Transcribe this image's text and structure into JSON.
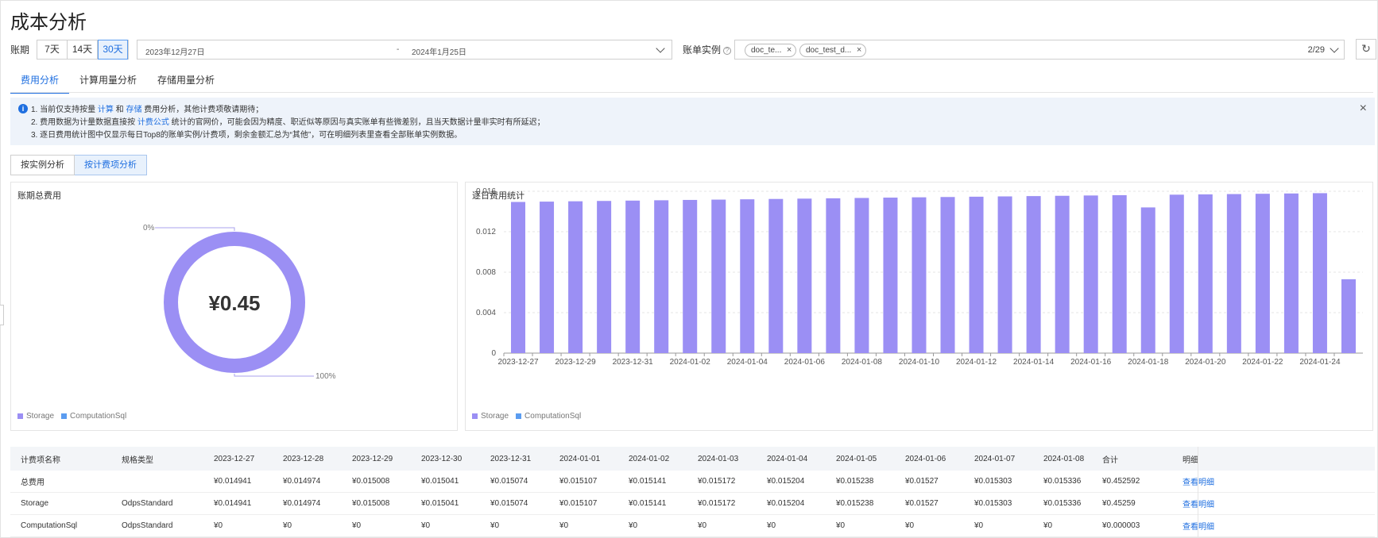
{
  "page": {
    "title": "成本分析"
  },
  "filters": {
    "period_label": "账期",
    "periods": [
      "7天",
      "14天",
      "30天"
    ],
    "active_period": "30天",
    "start_date": "2023年12月27日",
    "separator": "-",
    "end_date": "2024年1月25日",
    "instance_label": "账单实例",
    "help_icon_glyph": "?",
    "instance_tags": [
      "doc_te...",
      "doc_test_d..."
    ],
    "tag_close_glyph": "×",
    "instance_count": "2/29",
    "refresh_glyph": "↻"
  },
  "tabs": [
    "费用分析",
    "计算用量分析",
    "存储用量分析"
  ],
  "active_tab": "费用分析",
  "banner": {
    "info_glyph": "i",
    "close_glyph": "×",
    "line1_pre": "1. 当前仅支持按量 ",
    "line1_link1": "计算",
    "line1_mid": " 和 ",
    "line1_link2": "存储",
    "line1_post": " 费用分析，其他计费项敬请期待；",
    "line2_pre": "2. 费用数据为计量数据直接按 ",
    "line2_link": "计费公式",
    "line2_post": " 统计的官网价，可能会因为精度、职近似等原因与真实账单有些微差别，且当天数据计量非实时有所延迟；",
    "line3": "3. 逐日费用统计图中仅显示每日Top8的账单实例/计费项，剩余金额汇总为“其他”，可在明细列表里查看全部账单实例数据。"
  },
  "analysis_toggle": [
    "按实例分析",
    "按计费项分析"
  ],
  "active_toggle": "按计费项分析",
  "colors": {
    "storage": "#9b8ff4",
    "computation": "#5b9cf0",
    "accent": "#1f6fe0"
  },
  "donut_panel": {
    "title": "账期总费用",
    "center_value": "¥0.45",
    "label_top": "0%",
    "label_bottom": "100%"
  },
  "bar_panel": {
    "title": "逐日费用统计"
  },
  "legend": [
    "Storage",
    "ComputationSql"
  ],
  "chart_data": [
    {
      "type": "pie",
      "title": "账期总费用",
      "categories": [
        "Storage",
        "ComputationSql"
      ],
      "values": [
        0.45259,
        3e-06
      ],
      "center_label": "¥0.45"
    },
    {
      "type": "bar",
      "title": "逐日费用统计",
      "categories": [
        "2023-12-27",
        "2023-12-28",
        "2023-12-29",
        "2023-12-30",
        "2023-12-31",
        "2024-01-01",
        "2024-01-02",
        "2024-01-03",
        "2024-01-04",
        "2024-01-05",
        "2024-01-06",
        "2024-01-07",
        "2024-01-08",
        "2024-01-09",
        "2024-01-10",
        "2024-01-11",
        "2024-01-12",
        "2024-01-13",
        "2024-01-14",
        "2024-01-15",
        "2024-01-16",
        "2024-01-17",
        "2024-01-18",
        "2024-01-19",
        "2024-01-20",
        "2024-01-21",
        "2024-01-22",
        "2024-01-23",
        "2024-01-24",
        "2024-01-25"
      ],
      "x_tick_labels": [
        "2023-12-27",
        "2023-12-29",
        "2023-12-31",
        "2024-01-02",
        "2024-01-04",
        "2024-01-06",
        "2024-01-08",
        "2024-01-10",
        "2024-01-12",
        "2024-01-14",
        "2024-01-16",
        "2024-01-18",
        "2024-01-20",
        "2024-01-22",
        "2024-01-24"
      ],
      "series": [
        {
          "name": "Storage",
          "values": [
            0.014941,
            0.014974,
            0.015008,
            0.015041,
            0.015074,
            0.015107,
            0.015141,
            0.015172,
            0.015204,
            0.015238,
            0.01527,
            0.015303,
            0.015336,
            0.01537,
            0.0154,
            0.01543,
            0.01546,
            0.01549,
            0.01552,
            0.01555,
            0.01558,
            0.01561,
            0.0144,
            0.01566,
            0.01569,
            0.01572,
            0.01575,
            0.01578,
            0.01581,
            0.0073
          ]
        },
        {
          "name": "ComputationSql",
          "values": [
            0,
            0,
            0,
            0,
            0,
            0,
            0,
            0,
            0,
            0,
            0,
            0,
            0,
            0,
            0,
            0,
            0,
            0,
            0,
            0,
            0,
            0,
            0,
            0,
            0,
            0,
            0,
            0,
            0,
            3e-06
          ]
        }
      ],
      "y_ticks": [
        "0",
        "0.004",
        "0.008",
        "0.012",
        "0.016"
      ],
      "ylim": [
        0,
        0.016
      ]
    }
  ],
  "table": {
    "headers": [
      "计费项名称",
      "规格类型",
      "2023-12-27",
      "2023-12-28",
      "2023-12-29",
      "2023-12-30",
      "2023-12-31",
      "2024-01-01",
      "2024-01-02",
      "2024-01-03",
      "2024-01-04",
      "2024-01-05",
      "2024-01-06",
      "2024-01-07",
      "2024-01-08",
      "合计",
      "明细"
    ],
    "rows": [
      [
        "总费用",
        "",
        "¥0.014941",
        "¥0.014974",
        "¥0.015008",
        "¥0.015041",
        "¥0.015074",
        "¥0.015107",
        "¥0.015141",
        "¥0.015172",
        "¥0.015204",
        "¥0.015238",
        "¥0.01527",
        "¥0.015303",
        "¥0.015336",
        "¥0.452592",
        "查看明细"
      ],
      [
        "Storage",
        "OdpsStandard",
        "¥0.014941",
        "¥0.014974",
        "¥0.015008",
        "¥0.015041",
        "¥0.015074",
        "¥0.015107",
        "¥0.015141",
        "¥0.015172",
        "¥0.015204",
        "¥0.015238",
        "¥0.01527",
        "¥0.015303",
        "¥0.015336",
        "¥0.45259",
        "查看明细"
      ],
      [
        "ComputationSql",
        "OdpsStandard",
        "¥0",
        "¥0",
        "¥0",
        "¥0",
        "¥0",
        "¥0",
        "¥0",
        "¥0",
        "¥0",
        "¥0",
        "¥0",
        "¥0",
        "¥0",
        "¥0.000003",
        "查看明细"
      ]
    ]
  }
}
